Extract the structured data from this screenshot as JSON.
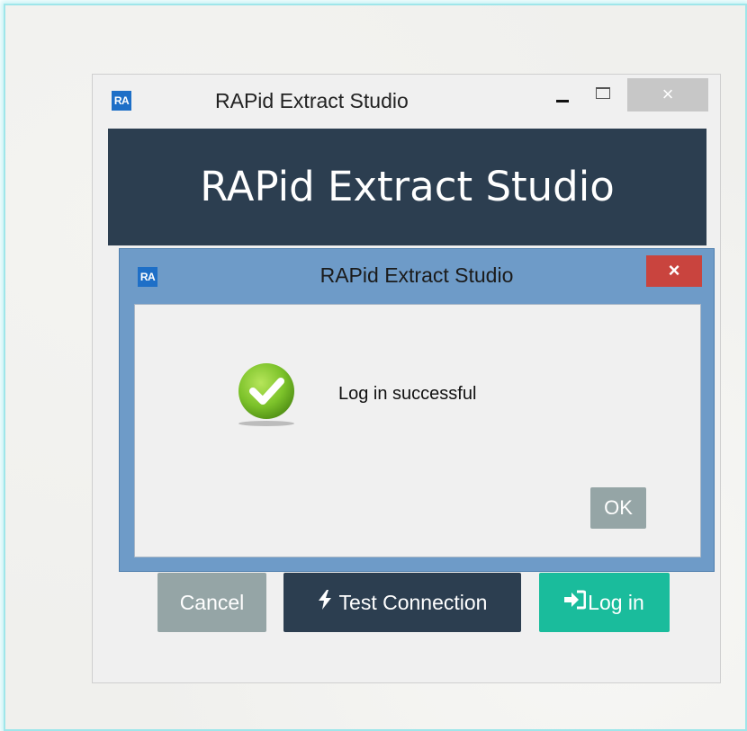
{
  "main_window": {
    "logo_text": "RA",
    "title": "RAPid Extract Studio",
    "close_glyph": "×",
    "banner_title": "RAPid Extract Studio",
    "buttons": {
      "cancel_label": "Cancel",
      "test_connection_label": "Test Connection",
      "test_connection_icon": "bolt-icon",
      "login_label": "Log in",
      "login_icon": "sign-in-icon"
    }
  },
  "dialog": {
    "logo_text": "RA",
    "title": "RAPid Extract Studio",
    "close_glyph": "×",
    "icon": "success-check-icon",
    "message": "Log in successful",
    "ok_label": "OK"
  },
  "colors": {
    "banner": "#2c3e50",
    "cancel": "#95a5a6",
    "test_connection": "#2c3e50",
    "login": "#1abc9c",
    "dialog_frame": "#6e9bc8",
    "dialog_close": "#c9443e",
    "success": "#7cc22a"
  }
}
